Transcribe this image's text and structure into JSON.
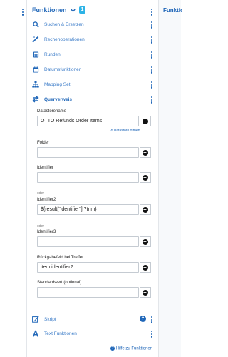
{
  "header": {
    "title": "Funktionen",
    "badge": "1",
    "right_title": "Funktion"
  },
  "menu": {
    "items": [
      {
        "label": "Suchen & Ersetzen",
        "icon": "search-icon"
      },
      {
        "label": "Rechenoperationen",
        "icon": "magic-wand-icon"
      },
      {
        "label": "Runden",
        "icon": "calculator-icon"
      },
      {
        "label": "Datumsfunktionen",
        "icon": "calendar-icon"
      },
      {
        "label": "Mapping Set",
        "icon": "sitemap-icon"
      },
      {
        "label": "Querverweis",
        "icon": "exchange-icon"
      }
    ],
    "bottom_items": [
      {
        "label": "Skript",
        "icon": "edit-icon",
        "help": "?"
      },
      {
        "label": "Text Funktionen",
        "icon": "font-icon"
      }
    ]
  },
  "form": {
    "datastore": {
      "label": "Datastorename",
      "value": "OTTO Refunds Order Items",
      "link": "Datastore öffnen"
    },
    "folder": {
      "label": "Folder",
      "value": ""
    },
    "identifier": {
      "label": "Identifier",
      "value": ""
    },
    "oder": "oder",
    "identifier2": {
      "label": "Identifier2",
      "value": "${result[\"identifier\"]!?trim}"
    },
    "identifier3": {
      "label": "Identifier3",
      "value": ""
    },
    "rueckgabefeld": {
      "label": "Rückgabefeld bei Treffer",
      "value": "item.identifier2"
    },
    "standardwert": {
      "label": "Standardwert (optional)",
      "value": ""
    }
  },
  "footer": {
    "help_link": "Hilfe zu Funktionen"
  },
  "colors": {
    "accent": "#1f66b8",
    "badge": "#2db3e6",
    "link": "#3a7bc8"
  }
}
